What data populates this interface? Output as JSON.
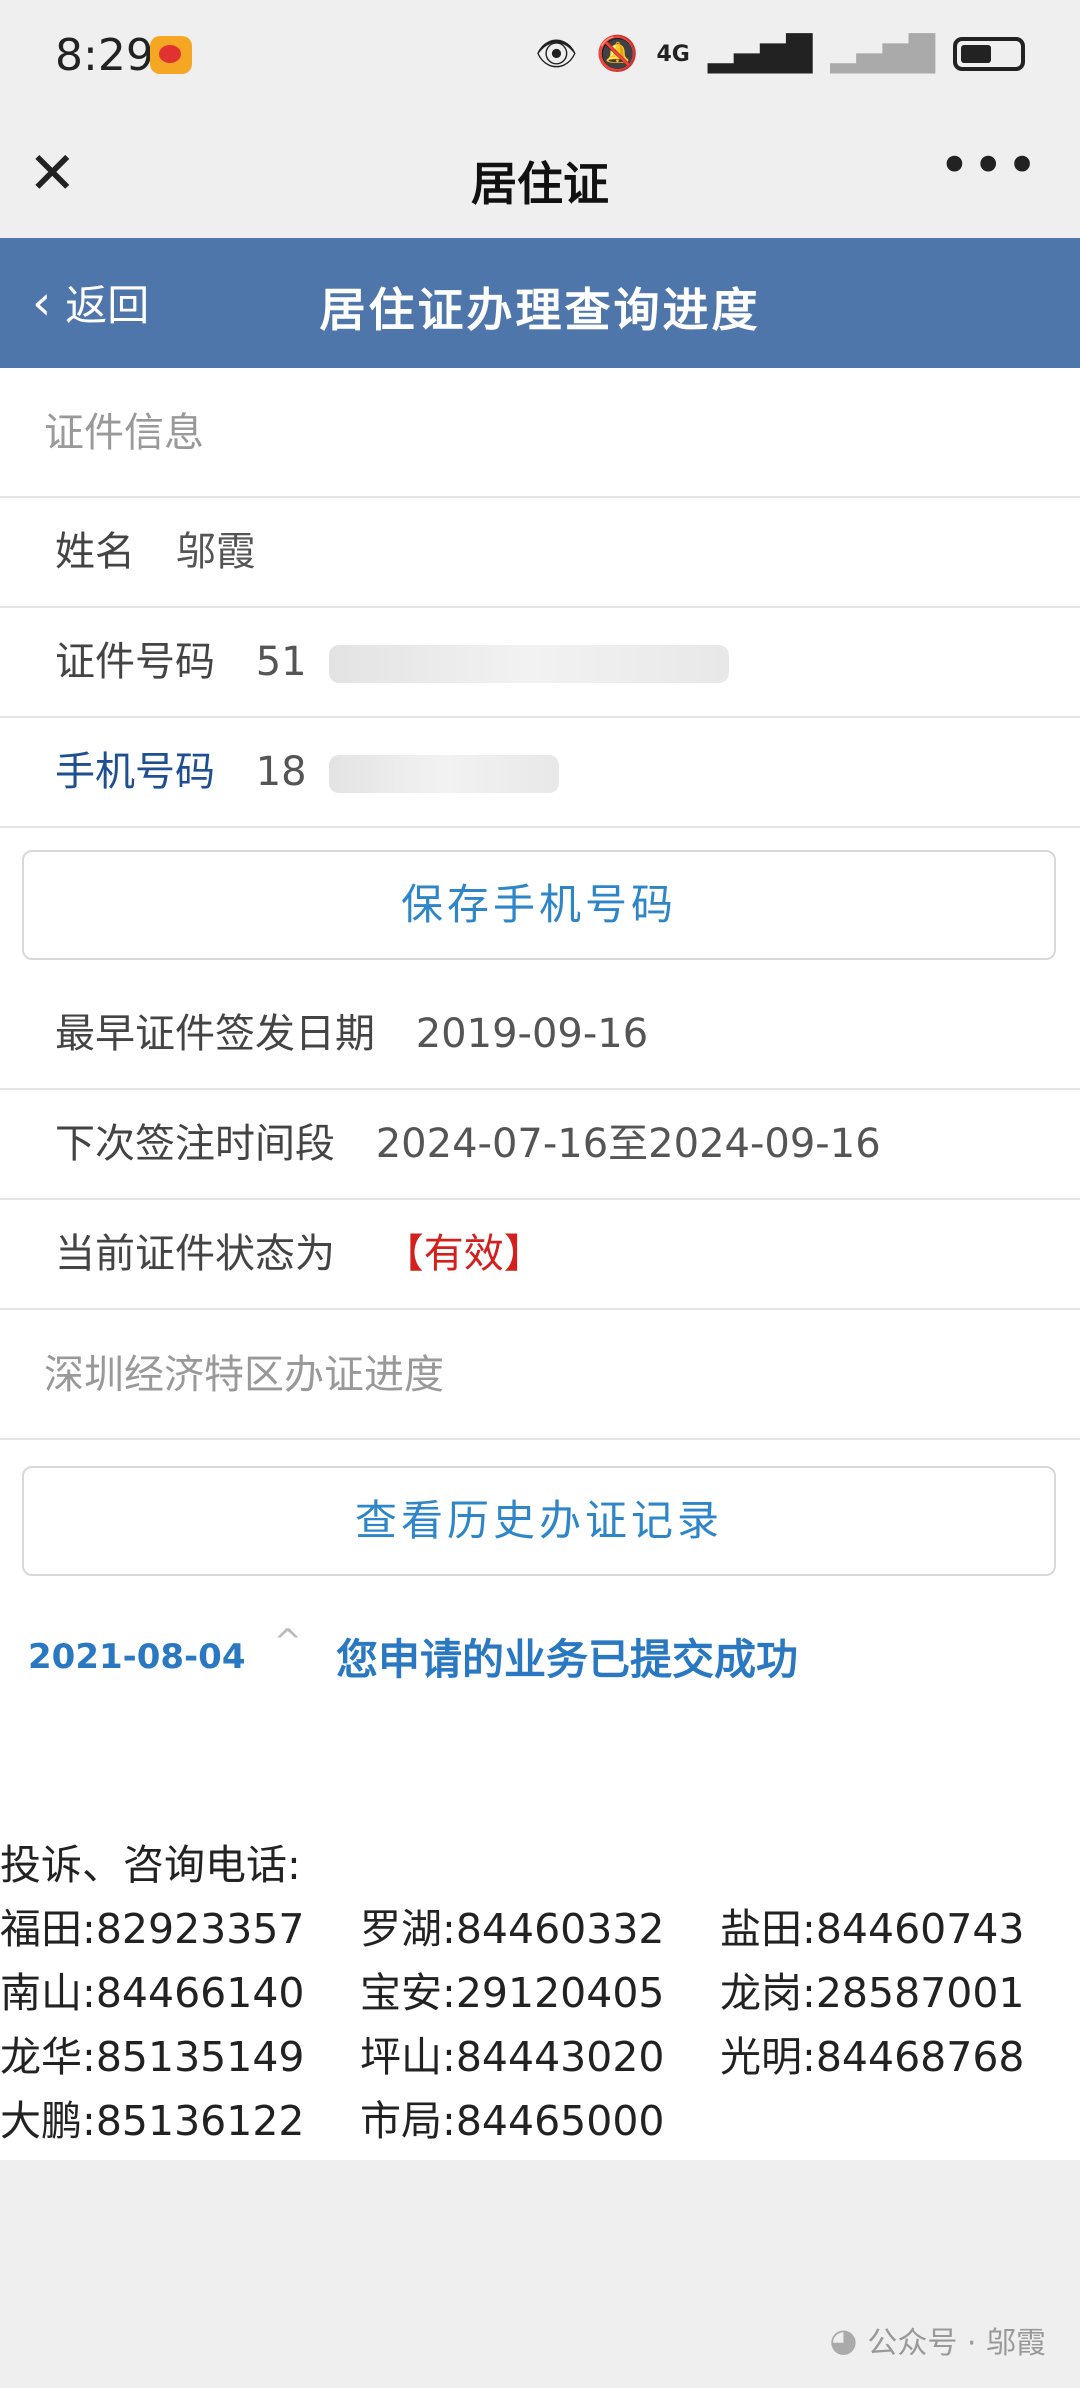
{
  "status_bar": {
    "time": "8:29",
    "network_label": "4G"
  },
  "nav": {
    "title": "居住证"
  },
  "page": {
    "back_label": "返回",
    "title": "居住证办理查询进度"
  },
  "cert_info": {
    "section_title": "证件信息",
    "name_label": "姓名",
    "name_value": "邬霞",
    "id_label": "证件号码",
    "id_value_prefix": "51",
    "phone_label": "手机号码",
    "phone_value_prefix": "18",
    "save_phone_button": "保存手机号码",
    "earliest_issue_label": "最早证件签发日期",
    "earliest_issue_value": "2019-09-16",
    "next_sign_label": "下次签注时间段",
    "next_sign_value": "2024-07-16至2024-09-16",
    "status_label": "当前证件状态为",
    "status_value": "【有效】"
  },
  "progress": {
    "section_title": "深圳经济特区办证进度",
    "history_button": "查看历史办证记录",
    "items": [
      {
        "date": "2021-08-04",
        "text": "您申请的业务已提交成功"
      }
    ]
  },
  "contacts": {
    "heading": "投诉、咨询电话:",
    "entries": [
      {
        "district": "福田:",
        "phone": "82923357"
      },
      {
        "district": "罗湖:",
        "phone": "84460332"
      },
      {
        "district": "盐田:",
        "phone": "84460743"
      },
      {
        "district": "南山:",
        "phone": "84466140"
      },
      {
        "district": "宝安:",
        "phone": "29120405"
      },
      {
        "district": "龙岗:",
        "phone": "28587001"
      },
      {
        "district": "龙华:",
        "phone": "85135149"
      },
      {
        "district": "坪山:",
        "phone": "84443020"
      },
      {
        "district": "光明:",
        "phone": "84468768"
      },
      {
        "district": "大鹏:",
        "phone": "85136122"
      },
      {
        "district": "市局:",
        "phone": "84465000"
      }
    ]
  },
  "watermark": "公众号 · 邬霞",
  "colors": {
    "header_blue": "#4f76aa",
    "link_blue": "#2e86c8",
    "status_red": "#d4201c"
  },
  "icons": [
    "close-icon",
    "more-icon",
    "back-chevron-icon",
    "caret-up-icon",
    "eye-icon",
    "bell-muted-icon",
    "signal-icon",
    "battery-icon",
    "wechat-icon"
  ]
}
